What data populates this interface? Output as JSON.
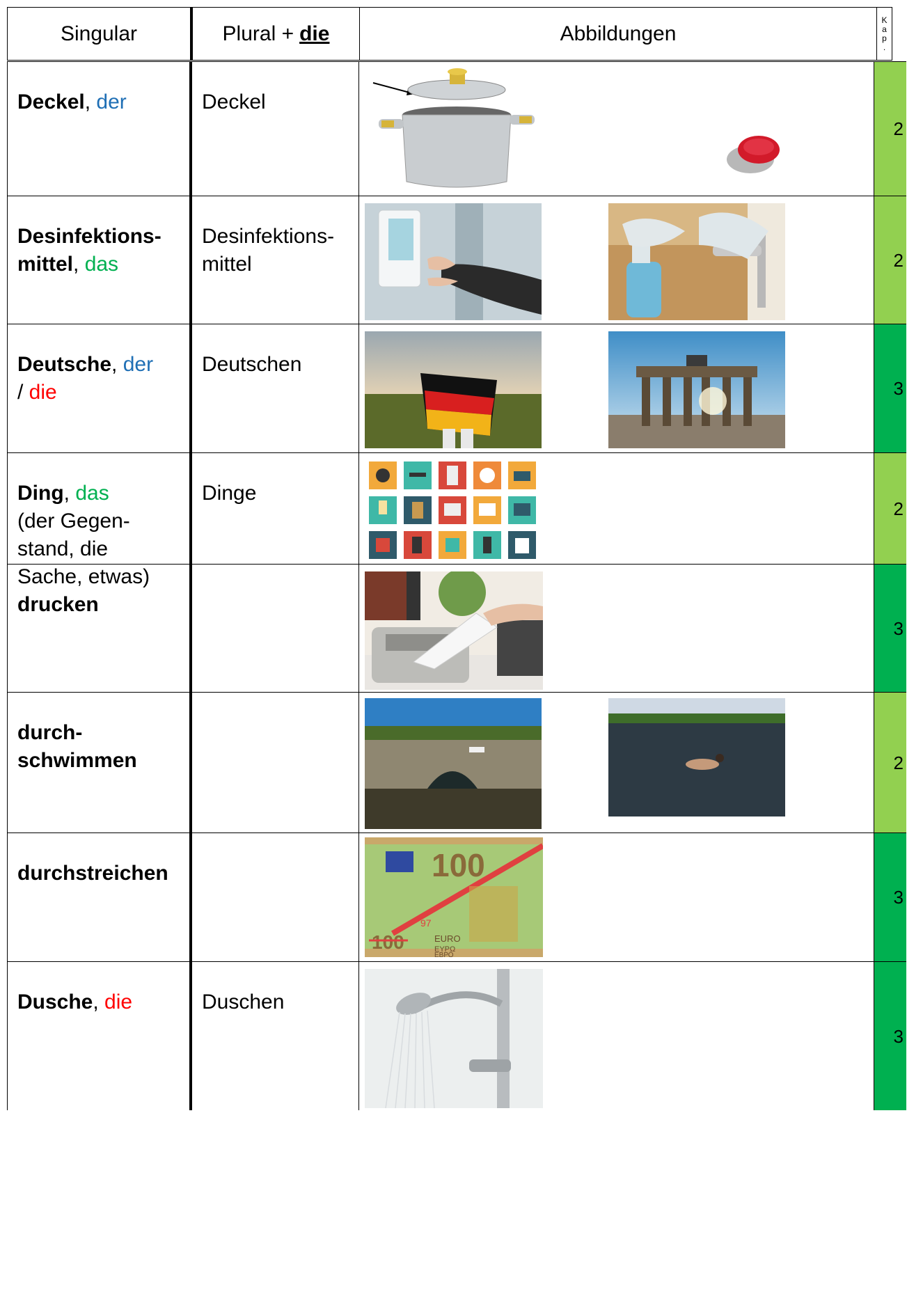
{
  "header": {
    "singular": "Singular",
    "plural": "Plural +",
    "plural_article": "die",
    "images": "Abbildungen",
    "kap": [
      "K",
      "a",
      "p",
      "."
    ]
  },
  "rows": [
    {
      "word": "Deckel",
      "sep": ", ",
      "article": "der",
      "article2": "",
      "note": "",
      "plural": "Deckel",
      "kap": "2"
    },
    {
      "word": "Desinfektions-\nmittel",
      "sep": ", ",
      "article": "das",
      "article2": "",
      "note": "",
      "plural": "Desinfektions-\nmittel",
      "kap": "2"
    },
    {
      "word": "Deutsche",
      "sep": ", ",
      "article": "der",
      "article2": "die",
      "note": "",
      "plural": "Deutschen",
      "kap": "3"
    },
    {
      "word": "Ding",
      "sep": ", ",
      "article": "das",
      "article2": "",
      "note": "(der Gegen-\nstand, die\nSache, etwas)",
      "plural": "Dinge",
      "kap": "2"
    },
    {
      "word": "drucken",
      "sep": "",
      "article": "",
      "article2": "",
      "note": "",
      "plural": "",
      "kap": "3"
    },
    {
      "word": "durch-\nschwimmen",
      "sep": "",
      "article": "",
      "article2": "",
      "note": "",
      "plural": "",
      "kap": "2"
    },
    {
      "word": "durchstreichen",
      "sep": "",
      "article": "",
      "article2": "",
      "note": "",
      "plural": "",
      "kap": "3"
    },
    {
      "word": "Dusche",
      "sep": ", ",
      "article": "die",
      "article2": "",
      "note": "",
      "plural": "Duschen",
      "kap": "3"
    }
  ],
  "colors": {
    "kap2": "#92d050",
    "kap3": "#00b050",
    "der": "#1f6fb5",
    "die": "#ff0000",
    "das": "#00b050"
  },
  "images": {
    "banknote": {
      "value": "100",
      "euro": "EURO",
      "euro_gr": "ΕΥΡΩ",
      "euro_bg": "ЕВРО",
      "struck": "100",
      "new_price": "97"
    }
  }
}
